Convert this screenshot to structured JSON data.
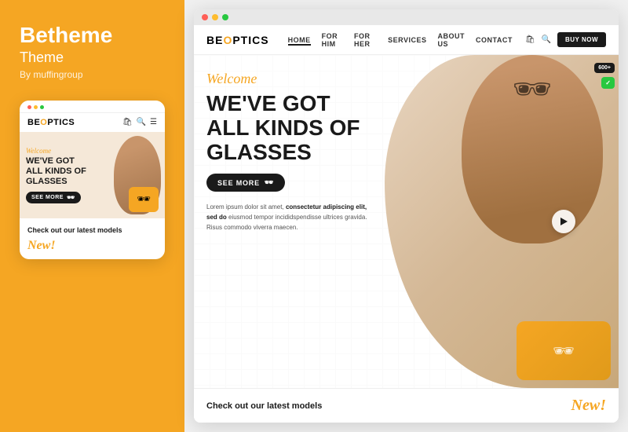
{
  "left": {
    "brand": "Betheme",
    "theme_label": "Theme",
    "by": "By muffingroup",
    "mobile": {
      "dots": [
        "red",
        "yellow",
        "green"
      ],
      "logo_prefix": "BE",
      "logo_suffix": "OPTICS",
      "welcome": "Welcome",
      "heading_line1": "WE'VE GOT",
      "heading_line2": "ALL KINDS OF",
      "heading_line3": "GLASSES",
      "see_more": "SEE MORE",
      "check_text": "Check out our latest models",
      "new_label": "New!"
    }
  },
  "right": {
    "titlebar_dots": [
      "red",
      "yellow",
      "green"
    ],
    "logo_prefix": "BE",
    "logo_suffix": "OPTICS",
    "nav": {
      "links": [
        "HOME",
        "FOR HIM",
        "FOR HER",
        "SERVICES",
        "ABOUT US",
        "CONTACT"
      ],
      "active": "HOME",
      "buy_now": "BUY NOW"
    },
    "hero": {
      "welcome": "Welcome",
      "heading_line1": "WE'VE GOT",
      "heading_line2": "ALL KINDS OF",
      "heading_line3": "GLASSES",
      "see_more": "SEE MORE",
      "desc": "Lorem ipsum dolor sit amet, consectetur adipiscing elit, sed do eiusmod tempor incididspendisse ultrices gravida. Risus commodo viverra maecen.",
      "counter": "600+",
      "play_button": "▶"
    },
    "bottom": {
      "check_text": "Check out our latest models",
      "new_label": "New!"
    }
  }
}
